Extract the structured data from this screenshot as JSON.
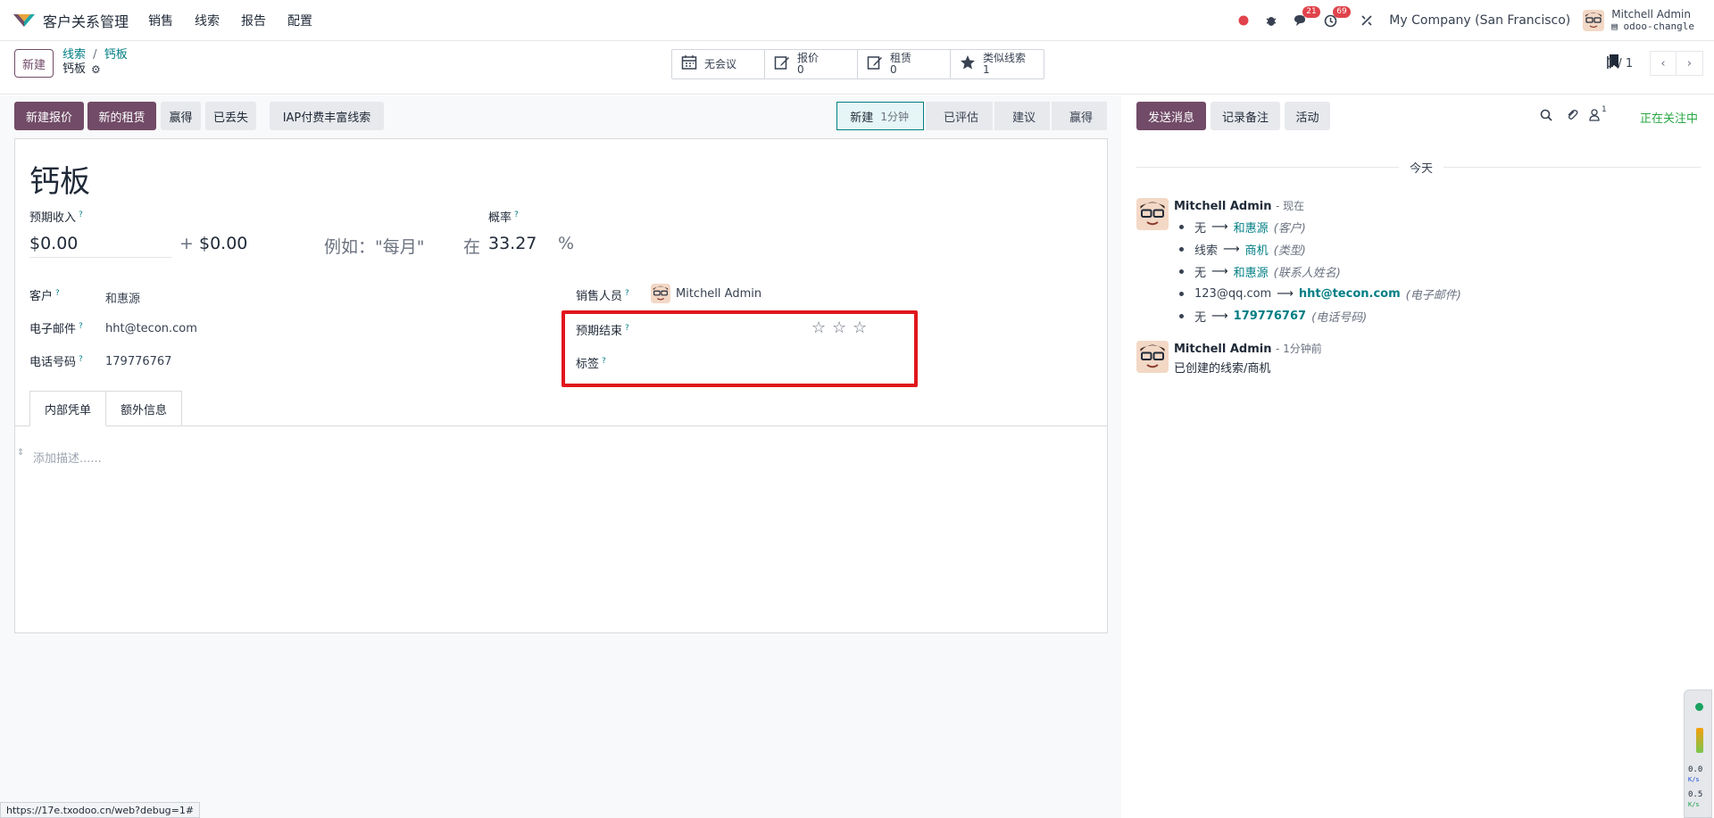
{
  "app": {
    "name": "客户关系管理",
    "menu": [
      "销售",
      "线索",
      "报告",
      "配置"
    ]
  },
  "systray": {
    "chat_count": "21",
    "activity_count": "69",
    "company": "My Company (San Francisco)",
    "user_name": "Mitchell Admin",
    "database": "odoo-changle"
  },
  "control": {
    "new_label": "新建",
    "breadcrumb_parent": "线索",
    "breadcrumb_current": "钙板",
    "breadcrumb_sub": "钙板",
    "smart_buttons": [
      {
        "icon": "calendar-icon",
        "label": "无会议",
        "value": ""
      },
      {
        "icon": "edit-icon",
        "label": "报价",
        "value": "0"
      },
      {
        "icon": "edit-icon",
        "label": "租赁",
        "value": "0"
      },
      {
        "icon": "star-icon",
        "label": "类似线索",
        "value": "1"
      }
    ],
    "pager": "1 / 1"
  },
  "actions": {
    "new_quote": "新建报价",
    "new_rental": "新的租赁",
    "won": "赢得",
    "lost": "已丢失",
    "iap_enrich": "IAP付费丰富线索"
  },
  "stages": [
    {
      "label": "新建",
      "duration": "1分钟",
      "current": true
    },
    {
      "label": "已评估",
      "duration": "",
      "current": false
    },
    {
      "label": "建议",
      "duration": "",
      "current": false
    },
    {
      "label": "赢得",
      "duration": "",
      "current": false
    }
  ],
  "form": {
    "title": "钙板",
    "expected_revenue_label": "预期收入",
    "probability_label": "概率",
    "revenue": "$0.00",
    "plus": "+",
    "recurring": "$0.00",
    "recurring_placeholder": "例如：\"每月\"",
    "at": "在",
    "probability": "33.27",
    "percent": "%",
    "customer_label": "客户",
    "customer": "和惠源",
    "email_label": "电子邮件",
    "email": "hht@tecon.com",
    "phone_label": "电话号码",
    "phone": "179776767",
    "salesperson_label": "销售人员",
    "salesperson": "Mitchell Admin",
    "expected_closing_label": "预期结束",
    "tags_label": "标签",
    "priority_stars": 0,
    "tabs": [
      "内部凭单",
      "额外信息"
    ],
    "description_placeholder": "添加描述......"
  },
  "chatter": {
    "send_message": "发送消息",
    "log_note": "记录备注",
    "activity": "活动",
    "followers_count": "1",
    "following": "正在关注中",
    "day": "今天",
    "messages": [
      {
        "author": "Mitchell Admin",
        "time": "- 现在",
        "tracking": [
          {
            "old": "无",
            "new": "和惠源",
            "field": "(客户)",
            "bold": false
          },
          {
            "old": "线索",
            "new": "商机",
            "field": "(类型)",
            "bold": false
          },
          {
            "old": "无",
            "new": "和惠源",
            "field": "(联系人姓名)",
            "bold": false
          },
          {
            "old": "123@qq.com",
            "new": "hht@tecon.com",
            "field": "(电子邮件)",
            "bold": true
          },
          {
            "old": "无",
            "new": "179776767",
            "field": "(电话号码)",
            "bold": true
          }
        ]
      },
      {
        "author": "Mitchell Admin",
        "time": "- 1分钟前",
        "body": "已创建的线索/商机"
      }
    ]
  },
  "status_url": "https://17e.txodoo.cn/web?debug=1#",
  "widget": {
    "down": "0.0",
    "down_unit": "K/s",
    "up": "0.5",
    "up_unit": "K/s"
  },
  "colors": {
    "brand": "#714B67",
    "link": "#017e84",
    "highlight": "#e0161c",
    "following": "#28a745"
  }
}
